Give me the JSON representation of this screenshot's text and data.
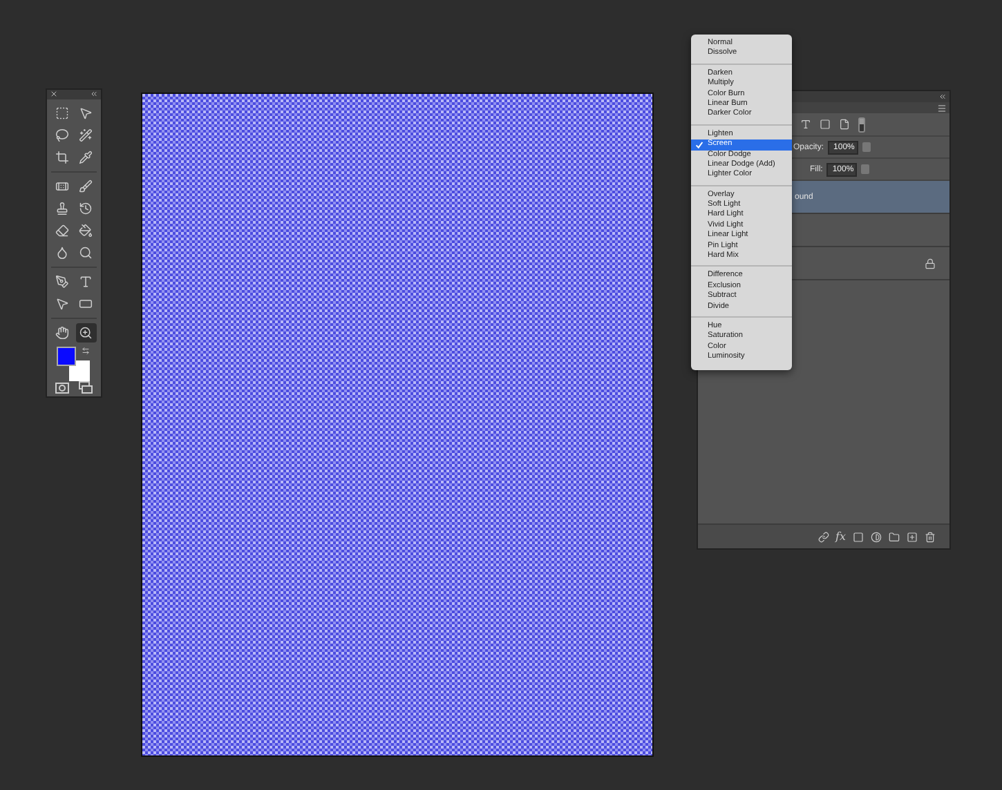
{
  "toolbox": {
    "tools": [
      {
        "kind": "marquee",
        "selected": false
      },
      {
        "kind": "move",
        "selected": false
      },
      {
        "kind": "lasso",
        "selected": false
      },
      {
        "kind": "quick-select",
        "selected": false
      },
      {
        "kind": "crop",
        "selected": false
      },
      {
        "kind": "eyedropper",
        "selected": false
      },
      {
        "kind": "healing",
        "selected": false
      },
      {
        "kind": "brush",
        "selected": false
      },
      {
        "kind": "stamp",
        "selected": false
      },
      {
        "kind": "history",
        "selected": false
      },
      {
        "kind": "eraser",
        "selected": false
      },
      {
        "kind": "bucket",
        "selected": false
      },
      {
        "kind": "blur",
        "selected": false
      },
      {
        "kind": "dodge",
        "selected": false
      },
      {
        "kind": "pen",
        "selected": false
      },
      {
        "kind": "type",
        "selected": false
      },
      {
        "kind": "path-select",
        "selected": false
      },
      {
        "kind": "rectangle",
        "selected": false
      },
      {
        "kind": "hand",
        "selected": false
      },
      {
        "kind": "zoom",
        "selected": true
      }
    ],
    "swatches": [
      {
        "kind": "foreground",
        "color": "#0a0aff"
      },
      {
        "kind": "background",
        "color": "#ffffff"
      }
    ]
  },
  "layers_panel": {
    "opacity": {
      "label": "Opacity:",
      "value": "100%"
    },
    "fill": {
      "label": "Fill:",
      "value": "100%"
    },
    "layers": [
      {
        "name": "ound",
        "selected": true,
        "locked": false
      },
      {
        "selected": false,
        "locked": false
      },
      {
        "selected": false,
        "locked": true
      }
    ],
    "footer": {
      "effects_label": "fx"
    }
  },
  "blend_menu": {
    "groups": [
      {
        "items": [
          {
            "label": "Normal",
            "selected": false
          },
          {
            "label": "Dissolve",
            "selected": false
          }
        ]
      },
      {
        "items": [
          {
            "label": "Darken",
            "selected": false
          },
          {
            "label": "Multiply",
            "selected": false
          },
          {
            "label": "Color Burn",
            "selected": false
          },
          {
            "label": "Linear Burn",
            "selected": false
          },
          {
            "label": "Darker Color",
            "selected": false
          }
        ]
      },
      {
        "items": [
          {
            "label": "Lighten",
            "selected": false
          },
          {
            "label": "Screen",
            "selected": true
          },
          {
            "label": "Color Dodge",
            "selected": false
          },
          {
            "label": "Linear Dodge (Add)",
            "selected": false
          },
          {
            "label": "Lighter Color",
            "selected": false
          }
        ]
      },
      {
        "items": [
          {
            "label": "Overlay",
            "selected": false
          },
          {
            "label": "Soft Light",
            "selected": false
          },
          {
            "label": "Hard Light",
            "selected": false
          },
          {
            "label": "Vivid Light",
            "selected": false
          },
          {
            "label": "Linear Light",
            "selected": false
          },
          {
            "label": "Pin Light",
            "selected": false
          },
          {
            "label": "Hard Mix",
            "selected": false
          }
        ]
      },
      {
        "items": [
          {
            "label": "Difference",
            "selected": false
          },
          {
            "label": "Exclusion",
            "selected": false
          },
          {
            "label": "Subtract",
            "selected": false
          },
          {
            "label": "Divide",
            "selected": false
          }
        ]
      },
      {
        "items": [
          {
            "label": "Hue",
            "selected": false
          },
          {
            "label": "Saturation",
            "selected": false
          },
          {
            "label": "Color",
            "selected": false
          },
          {
            "label": "Luminosity",
            "selected": false
          }
        ]
      }
    ]
  }
}
